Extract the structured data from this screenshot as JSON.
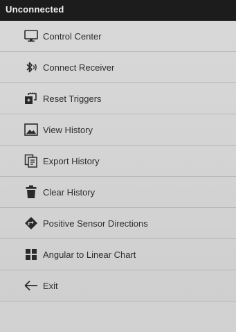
{
  "window": {
    "title": "Unconnected"
  },
  "menu": {
    "items": [
      {
        "label": "Control Center",
        "icon": "monitor-icon"
      },
      {
        "label": "Connect Receiver",
        "icon": "bluetooth-icon"
      },
      {
        "label": "Reset Triggers",
        "icon": "reset-triggers-icon"
      },
      {
        "label": "View History",
        "icon": "image-icon"
      },
      {
        "label": "Export History",
        "icon": "export-icon"
      },
      {
        "label": "Clear History",
        "icon": "trash-icon"
      },
      {
        "label": "Positive Sensor Directions",
        "icon": "direction-diamond-icon"
      },
      {
        "label": "Angular to Linear Chart",
        "icon": "grid-icon"
      },
      {
        "label": "Exit",
        "icon": "back-arrow-icon"
      }
    ]
  },
  "colors": {
    "title_bar_bg": "#1c1c1c",
    "title_text": "#f2f2f2",
    "menu_bg": "#d2d2d2",
    "menu_text": "#2e2e2e",
    "divider": "#b6b6b6",
    "icon": "#2a2a2a"
  }
}
